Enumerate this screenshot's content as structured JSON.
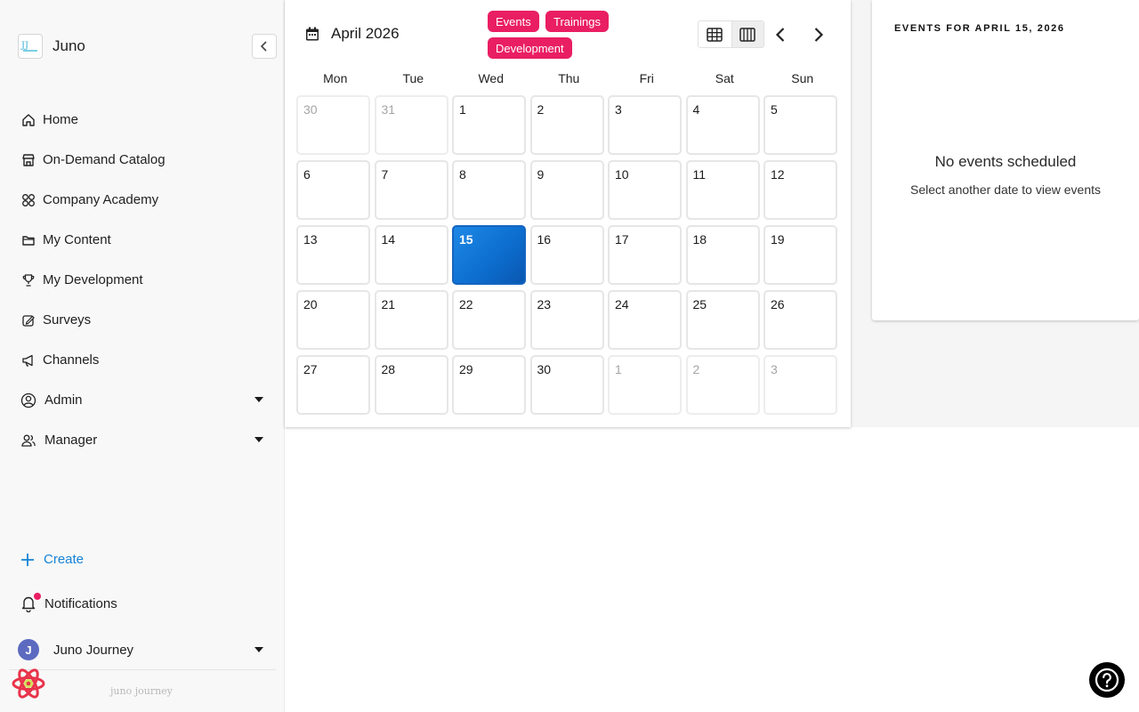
{
  "brand": {
    "name": "Juno",
    "logo_icon": "juno-journey-logo-icon"
  },
  "sidebar": {
    "items": [
      {
        "label": "Home",
        "icon": "home-icon"
      },
      {
        "label": "On-Demand Catalog",
        "icon": "store-icon"
      },
      {
        "label": "Company Academy",
        "icon": "grid-circles-icon"
      },
      {
        "label": "My Content",
        "icon": "folder-icon"
      },
      {
        "label": "My Development",
        "icon": "trophy-icon"
      },
      {
        "label": "Surveys",
        "icon": "survey-icon"
      },
      {
        "label": "Channels",
        "icon": "megaphone-icon"
      },
      {
        "label": "Admin",
        "icon": "user-circle-icon",
        "expandable": true
      },
      {
        "label": "Manager",
        "icon": "users-icon",
        "expandable": true
      }
    ],
    "create_label": "Create",
    "notifications_label": "Notifications",
    "user": {
      "initial": "J",
      "name": "Juno Journey"
    },
    "footer_brand": "juno journey"
  },
  "calendar": {
    "title": "April 2026",
    "filters": [
      "Events",
      "Trainings",
      "Development"
    ],
    "weekdays": [
      "Mon",
      "Tue",
      "Wed",
      "Thu",
      "Fri",
      "Sat",
      "Sun"
    ],
    "weeks": [
      [
        "30",
        "31",
        "1",
        "2",
        "3",
        "4",
        "5"
      ],
      [
        "6",
        "7",
        "8",
        "9",
        "10",
        "11",
        "12"
      ],
      [
        "13",
        "14",
        "15",
        "16",
        "17",
        "18",
        "19"
      ],
      [
        "20",
        "21",
        "22",
        "23",
        "24",
        "25",
        "26"
      ],
      [
        "27",
        "28",
        "29",
        "30",
        "1",
        "2",
        "3"
      ]
    ],
    "outside_month": [
      [
        0,
        0
      ],
      [
        0,
        1
      ],
      [
        4,
        4
      ],
      [
        4,
        5
      ],
      [
        4,
        6
      ]
    ],
    "selected": [
      2,
      2
    ],
    "selected_color": "#1e88e5",
    "chip_color": "#e91e63"
  },
  "events_panel": {
    "title": "EVENTS FOR APRIL 15, 2026",
    "empty_title": "No events scheduled",
    "empty_subtitle": "Select another date to view events"
  }
}
